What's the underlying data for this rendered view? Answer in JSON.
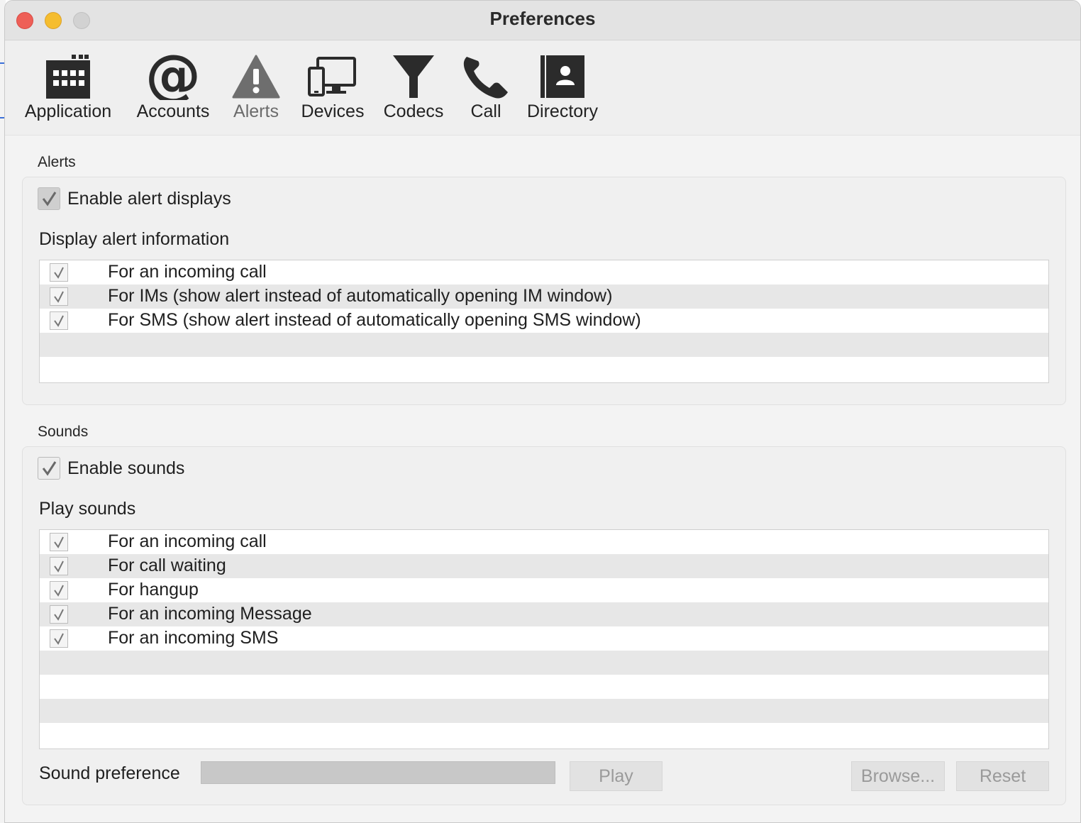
{
  "window": {
    "title": "Preferences"
  },
  "toolbar": {
    "items": [
      {
        "label": "Application",
        "icon": "calendar-grid-icon"
      },
      {
        "label": "Accounts",
        "icon": "at-sign-icon"
      },
      {
        "label": "Alerts",
        "icon": "warning-triangle-icon",
        "selected": true
      },
      {
        "label": "Devices",
        "icon": "devices-icon"
      },
      {
        "label": "Codecs",
        "icon": "funnel-icon"
      },
      {
        "label": "Call",
        "icon": "phone-icon"
      },
      {
        "label": "Directory",
        "icon": "contact-book-icon"
      }
    ]
  },
  "alerts": {
    "section_label": "Alerts",
    "enable_label": "Enable alert displays",
    "enable_checked": true,
    "display_label": "Display alert information",
    "items": [
      {
        "label": "For an incoming call",
        "checked": true
      },
      {
        "label": "For IMs (show alert instead of automatically opening IM window)",
        "checked": true
      },
      {
        "label": "For SMS (show alert instead of automatically opening SMS window)",
        "checked": true
      }
    ]
  },
  "sounds": {
    "section_label": "Sounds",
    "enable_label": "Enable sounds",
    "enable_checked": true,
    "play_label": "Play sounds",
    "items": [
      {
        "label": "For an incoming call",
        "checked": true
      },
      {
        "label": "For call waiting",
        "checked": true
      },
      {
        "label": "For hangup",
        "checked": true
      },
      {
        "label": "For an incoming Message",
        "checked": true
      },
      {
        "label": "For an incoming SMS",
        "checked": true
      }
    ],
    "sound_preference_label": "Sound preference",
    "sound_preference_value": "",
    "play_button": "Play",
    "browse_button": "Browse...",
    "reset_button": "Reset"
  },
  "colors": {
    "close": "#ee5f57",
    "minimize": "#f5bd2f",
    "maximize_disabled": "#d2d2d2"
  }
}
